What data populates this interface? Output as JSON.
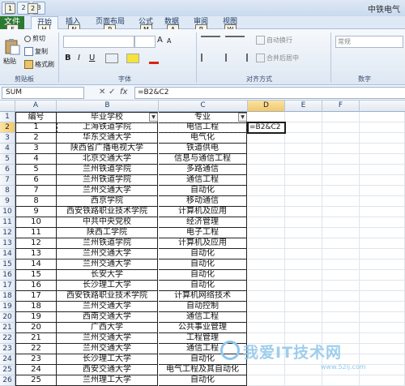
{
  "app": {
    "title": "中铁电气",
    "qat": [
      "1",
      "2",
      "3"
    ],
    "qat_keytips": [
      "1",
      "2"
    ]
  },
  "tabs": [
    {
      "label": "文件",
      "key": "F"
    },
    {
      "label": "开始",
      "key": "H"
    },
    {
      "label": "插入",
      "key": "N"
    },
    {
      "label": "页面布局",
      "key": "P"
    },
    {
      "label": "公式",
      "key": "M"
    },
    {
      "label": "数据",
      "key": "A"
    },
    {
      "label": "审阅",
      "key": "R"
    },
    {
      "label": "视图",
      "key": "W"
    }
  ],
  "ribbon": {
    "clipboard": {
      "paste": "粘贴",
      "cut": "剪切",
      "copy": "复制",
      "format_painter": "格式刷",
      "label": "剪贴板"
    },
    "font": {
      "bold": "B",
      "italic": "I",
      "underline": "U",
      "label": "字体",
      "size_a_big": "A",
      "size_a_small": "A"
    },
    "alignment": {
      "wrap": "自动换行",
      "merge": "合并后居中",
      "label": "对齐方式"
    },
    "number": {
      "format": "常规",
      "label": "数字"
    }
  },
  "formula_bar": {
    "name_box": "SUM",
    "cancel": "✕",
    "enter": "✓",
    "fx": "fx",
    "formula": "=B2&C2"
  },
  "sheet": {
    "columns": [
      "A",
      "B",
      "C",
      "D",
      "E",
      "F"
    ],
    "headers": {
      "A": "编号",
      "B": "毕业学校",
      "C": "专业"
    },
    "editing_text": "=B2&C2",
    "rows": [
      {
        "n": "1",
        "a": "编号",
        "b": "毕业学校",
        "c": "专业"
      },
      {
        "n": "2",
        "a": "1",
        "b": "上海铁道学院",
        "c": "电信工程"
      },
      {
        "n": "3",
        "a": "2",
        "b": "华东交通大学",
        "c": "电气化"
      },
      {
        "n": "4",
        "a": "3",
        "b": "陕西省广播电视大学",
        "c": "铁道供电"
      },
      {
        "n": "5",
        "a": "4",
        "b": "北京交通大学",
        "c": "信息与通信工程"
      },
      {
        "n": "6",
        "a": "5",
        "b": "兰州铁道学院",
        "c": "多路通信"
      },
      {
        "n": "7",
        "a": "6",
        "b": "兰州铁道学院",
        "c": "通信工程"
      },
      {
        "n": "8",
        "a": "7",
        "b": "兰州交通大学",
        "c": "自动化"
      },
      {
        "n": "9",
        "a": "8",
        "b": "西京学院",
        "c": "移动通信"
      },
      {
        "n": "10",
        "a": "9",
        "b": "西安铁路职业技术学院",
        "c": "计算机及应用"
      },
      {
        "n": "11",
        "a": "10",
        "b": "中共中央党校",
        "c": "经济管理"
      },
      {
        "n": "12",
        "a": "11",
        "b": "陕西工学院",
        "c": "电子工程"
      },
      {
        "n": "13",
        "a": "12",
        "b": "兰州铁道学院",
        "c": "计算机及应用"
      },
      {
        "n": "14",
        "a": "13",
        "b": "兰州交通大学",
        "c": "自动化"
      },
      {
        "n": "15",
        "a": "14",
        "b": "兰州交通大学",
        "c": "自动化"
      },
      {
        "n": "16",
        "a": "15",
        "b": "长安大学",
        "c": "自动化"
      },
      {
        "n": "17",
        "a": "16",
        "b": "长沙理工大学",
        "c": "自动化"
      },
      {
        "n": "18",
        "a": "17",
        "b": "西安铁路职业技术学院",
        "c": "计算机网络技术"
      },
      {
        "n": "19",
        "a": "18",
        "b": "兰州交通大学",
        "c": "自动控制"
      },
      {
        "n": "20",
        "a": "19",
        "b": "西南交通大学",
        "c": "通信工程"
      },
      {
        "n": "21",
        "a": "20",
        "b": "广西大学",
        "c": "公共事业管理"
      },
      {
        "n": "22",
        "a": "21",
        "b": "兰州交通大学",
        "c": "工程管理"
      },
      {
        "n": "23",
        "a": "22",
        "b": "兰州交通大学",
        "c": "通信工程"
      },
      {
        "n": "24",
        "a": "23",
        "b": "长沙理工大学",
        "c": "自动化"
      },
      {
        "n": "25",
        "a": "24",
        "b": "西安交通大学",
        "c": "电气工程及其自动化"
      },
      {
        "n": "26",
        "a": "25",
        "b": "兰州理工大学",
        "c": "自动化"
      }
    ]
  },
  "watermark": {
    "text": "我爱IT技术网",
    "url": "www.52ij.com"
  }
}
